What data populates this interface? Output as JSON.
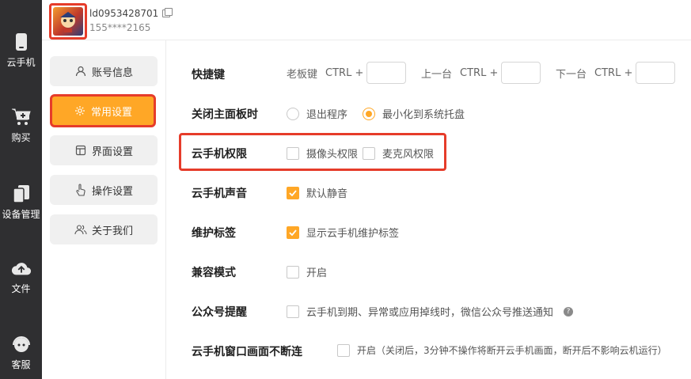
{
  "nav": {
    "items": [
      {
        "label": "云手机",
        "icon": "phone-icon"
      },
      {
        "label": "购买",
        "icon": "cart-icon"
      },
      {
        "label": "设备管理",
        "icon": "devices-icon"
      },
      {
        "label": "文件",
        "icon": "cloud-upload-icon"
      },
      {
        "label": "客服",
        "icon": "support-icon"
      }
    ]
  },
  "account": {
    "user_id": "ld0953428701",
    "phone": "155****2165"
  },
  "settings_menu": [
    {
      "label": "账号信息",
      "icon": "user-icon"
    },
    {
      "label": "常用设置",
      "icon": "gear-icon",
      "active": true
    },
    {
      "label": "界面设置",
      "icon": "layout-icon"
    },
    {
      "label": "操作设置",
      "icon": "hand-icon"
    },
    {
      "label": "关于我们",
      "icon": "people-icon"
    }
  ],
  "settings": {
    "hotkeys": {
      "label": "快捷键",
      "items": [
        {
          "name": "老板键",
          "ctrl": "CTRL +",
          "value": ""
        },
        {
          "name": "上一台",
          "ctrl": "CTRL +",
          "value": ""
        },
        {
          "name": "下一台",
          "ctrl": "CTRL +",
          "value": ""
        }
      ]
    },
    "close_panel": {
      "label": "关闭主面板时",
      "options": [
        {
          "label": "退出程序",
          "selected": false
        },
        {
          "label": "最小化到系统托盘",
          "selected": true
        }
      ]
    },
    "permissions": {
      "label": "云手机权限",
      "options": [
        {
          "label": "摄像头权限",
          "checked": false
        },
        {
          "label": "麦克风权限",
          "checked": false
        }
      ]
    },
    "sound": {
      "label": "云手机声音",
      "option": "默认静音",
      "checked": true
    },
    "maintenance": {
      "label": "维护标签",
      "option": "显示云手机维护标签",
      "checked": true
    },
    "compat": {
      "label": "兼容模式",
      "option": "开启",
      "checked": false
    },
    "wechat": {
      "label": "公众号提醒",
      "option": "云手机到期、异常或应用掉线时，微信公众号推送通知",
      "checked": false
    },
    "keepalive": {
      "label": "云手机窗口画面不断连",
      "option": "开启（关闭后，3分钟不操作将断开云手机画面，断开后不影响云机运行）",
      "checked": false
    }
  },
  "colors": {
    "accent": "#ffa726",
    "highlight": "#e63c2a",
    "nav_bg": "#2f2f31"
  }
}
